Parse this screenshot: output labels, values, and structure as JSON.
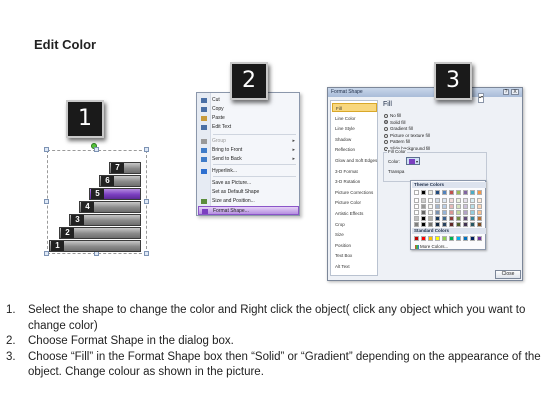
{
  "title": "Edit Color",
  "badges": [
    "1",
    "2",
    "3"
  ],
  "stairs": {
    "steps": [
      "1",
      "2",
      "3",
      "4",
      "5",
      "6",
      "7"
    ],
    "selected_step": "5",
    "selected_color": "#7b3fc0"
  },
  "context_menu": {
    "items": [
      {
        "label": "Cut",
        "icon": "scissors-icon",
        "disabled": false,
        "submenu": false
      },
      {
        "label": "Copy",
        "icon": "copy-icon",
        "disabled": false,
        "submenu": false
      },
      {
        "label": "Paste",
        "icon": "paste-icon",
        "disabled": false,
        "submenu": false
      },
      {
        "label": "Edit Text",
        "icon": "edit-text-icon",
        "disabled": false,
        "submenu": false
      },
      {
        "label": "Group",
        "icon": "group-icon",
        "disabled": true,
        "submenu": true
      },
      {
        "label": "Bring to Front",
        "icon": "bring-front-icon",
        "disabled": false,
        "submenu": true
      },
      {
        "label": "Send to Back",
        "icon": "send-back-icon",
        "disabled": false,
        "submenu": true
      },
      {
        "label": "Hyperlink...",
        "icon": "hyperlink-icon",
        "disabled": false,
        "submenu": false
      },
      {
        "label": "Save as Picture...",
        "icon": "",
        "disabled": false,
        "submenu": false
      },
      {
        "label": "Set as Default Shape",
        "icon": "",
        "disabled": false,
        "submenu": false
      },
      {
        "label": "Size and Position...",
        "icon": "size-icon",
        "disabled": false,
        "submenu": false
      },
      {
        "label": "Format Shape...",
        "icon": "format-shape-icon",
        "disabled": false,
        "submenu": false,
        "highlighted": true
      }
    ]
  },
  "format_dialog": {
    "title": "Format Shape",
    "help": "?",
    "close_x": "X",
    "nav": [
      "Fill",
      "Line Color",
      "Line Style",
      "Shadow",
      "Reflection",
      "Glow and Soft Edges",
      "3-D Format",
      "3-D Rotation",
      "Picture Corrections",
      "Picture Color",
      "Artistic Effects",
      "Crop",
      "Size",
      "Position",
      "Text Box",
      "Alt Text"
    ],
    "nav_selected": "Fill",
    "fill_heading": "Fill",
    "fill_options": [
      "No fill",
      "Solid fill",
      "Gradient fill",
      "Picture or texture fill",
      "Pattern fill",
      "Slide background fill"
    ],
    "fill_selected": "Solid fill",
    "fill_color_group": "Fill Color",
    "color_label": "Color:",
    "transparency_label": "Transpa",
    "theme_colors_label": "Theme Colors",
    "standard_colors_label": "Standard Colors",
    "more_colors_label": "More Colors...",
    "close_button": "Close",
    "theme_top_row": [
      "#ffffff",
      "#000000",
      "#eeece1",
      "#1f497d",
      "#4f81bd",
      "#c0504d",
      "#9bbb59",
      "#8064a2",
      "#4bacc6",
      "#f79646"
    ],
    "standard_colors": [
      "#c00000",
      "#ff0000",
      "#ffc000",
      "#ffff00",
      "#92d050",
      "#00b050",
      "#00b0f0",
      "#0070c0",
      "#002060",
      "#7030a0"
    ]
  },
  "instructions": [
    {
      "num": "1.",
      "text": "Select the shape to change the color and Right click the object( click any object which you want to change color)"
    },
    {
      "num": "2.",
      "text": "Choose Format Shape in the dialog box."
    },
    {
      "num": "3.",
      "text": "Choose “Fill” in the Format Shape box then “Solid” or “Gradient” depending on the appearance of the object. Change colour as shown in the picture."
    }
  ]
}
